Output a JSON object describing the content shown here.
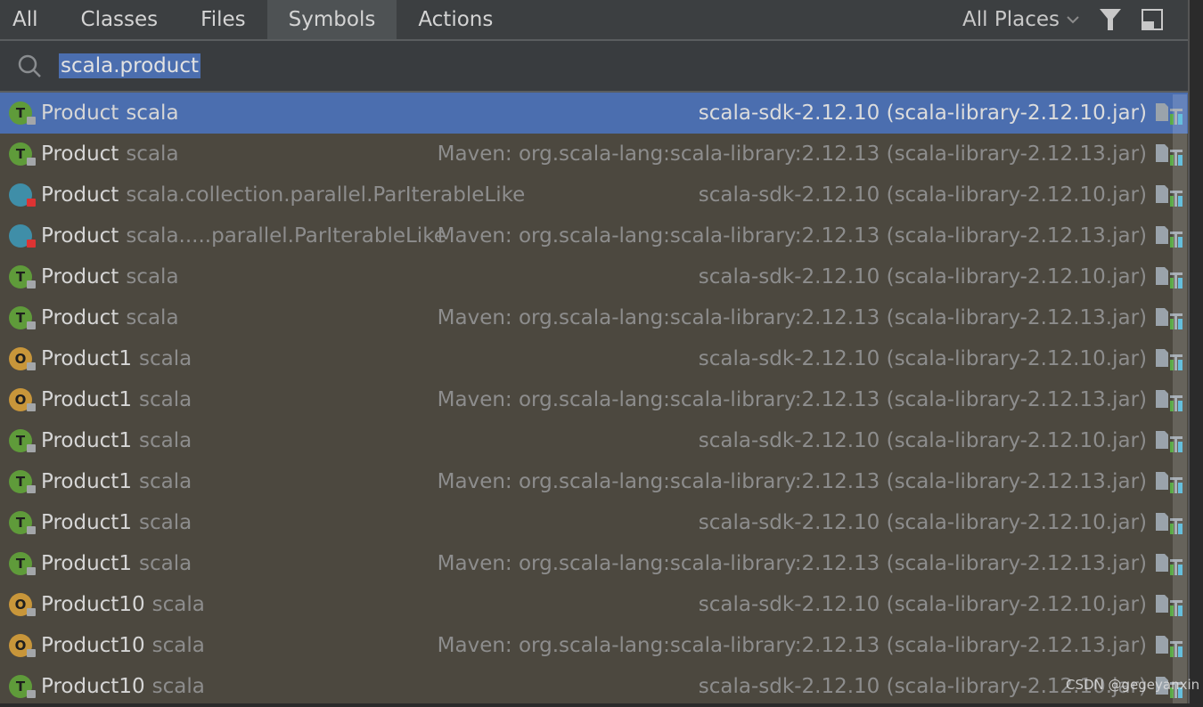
{
  "tabs": [
    {
      "label": "All"
    },
    {
      "label": "Classes"
    },
    {
      "label": "Files"
    },
    {
      "label": "Symbols",
      "selected": true
    },
    {
      "label": "Actions"
    }
  ],
  "scope": {
    "label": "All Places"
  },
  "search": {
    "value": "scala.product"
  },
  "colors": {
    "selection": "#4b6eaf",
    "trait": "#5f9b3a",
    "class": "#3f8ea8",
    "object": "#c8963a",
    "background": "#4c483f"
  },
  "results": [
    {
      "kind": "T",
      "name": "Product",
      "pkg": "scala",
      "loc": "scala-sdk-2.12.10 (scala-library-2.12.10.jar)",
      "selected": true
    },
    {
      "kind": "T",
      "name": "Product",
      "pkg": "scala",
      "loc": "Maven: org.scala-lang:scala-library:2.12.13 (scala-library-2.12.13.jar)"
    },
    {
      "kind": "C",
      "name": "Product",
      "pkg": "scala.collection.parallel.ParIterableLike",
      "loc": "scala-sdk-2.12.10 (scala-library-2.12.10.jar)"
    },
    {
      "kind": "C",
      "name": "Product",
      "pkg": "scala.....parallel.ParIterableLike",
      "loc": "Maven: org.scala-lang:scala-library:2.12.13 (scala-library-2.12.13.jar)"
    },
    {
      "kind": "T",
      "name": "Product",
      "pkg": "scala",
      "loc": "scala-sdk-2.12.10 (scala-library-2.12.10.jar)"
    },
    {
      "kind": "T",
      "name": "Product",
      "pkg": "scala",
      "loc": "Maven: org.scala-lang:scala-library:2.12.13 (scala-library-2.12.13.jar)"
    },
    {
      "kind": "O",
      "name": "Product1",
      "pkg": "scala",
      "loc": "scala-sdk-2.12.10 (scala-library-2.12.10.jar)"
    },
    {
      "kind": "O",
      "name": "Product1",
      "pkg": "scala",
      "loc": "Maven: org.scala-lang:scala-library:2.12.13 (scala-library-2.12.13.jar)"
    },
    {
      "kind": "T",
      "name": "Product1",
      "pkg": "scala",
      "loc": "scala-sdk-2.12.10 (scala-library-2.12.10.jar)"
    },
    {
      "kind": "T",
      "name": "Product1",
      "pkg": "scala",
      "loc": "Maven: org.scala-lang:scala-library:2.12.13 (scala-library-2.12.13.jar)"
    },
    {
      "kind": "T",
      "name": "Product1",
      "pkg": "scala",
      "loc": "scala-sdk-2.12.10 (scala-library-2.12.10.jar)"
    },
    {
      "kind": "T",
      "name": "Product1",
      "pkg": "scala",
      "loc": "Maven: org.scala-lang:scala-library:2.12.13 (scala-library-2.12.13.jar)"
    },
    {
      "kind": "O",
      "name": "Product10",
      "pkg": "scala",
      "loc": "scala-sdk-2.12.10 (scala-library-2.12.10.jar)"
    },
    {
      "kind": "O",
      "name": "Product10",
      "pkg": "scala",
      "loc": "Maven: org.scala-lang:scala-library:2.12.13 (scala-library-2.12.13.jar)"
    },
    {
      "kind": "T",
      "name": "Product10",
      "pkg": "scala",
      "loc": "scala-sdk-2.12.10 (scala-library-2.12.10.jar)"
    }
  ],
  "watermark": "CSDN @gegeyanxin"
}
